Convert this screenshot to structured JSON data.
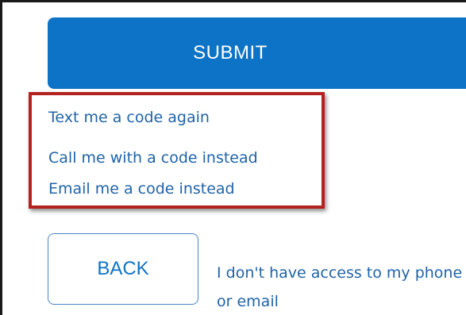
{
  "buttons": {
    "submit_label": "SUBMIT",
    "back_label": "BACK"
  },
  "code_options": {
    "text_again": "Text me a code again",
    "call_instead": "Call me with a code instead",
    "email_instead": "Email me a code instead"
  },
  "no_access_link": "I don't have access to my phone or email",
  "colors": {
    "primary_blue": "#0d73c6",
    "link_blue": "#1f63a8",
    "highlight_red": "#b3221e"
  }
}
